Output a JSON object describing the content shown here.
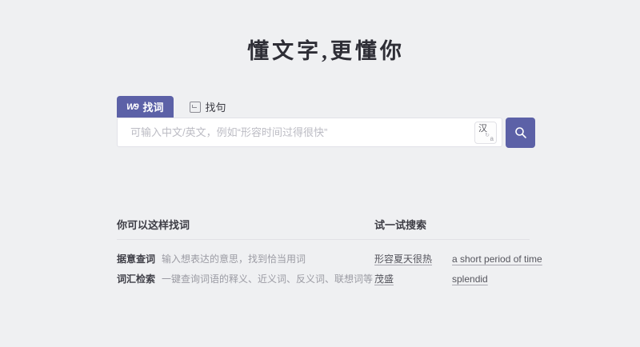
{
  "page": {
    "title": "懂文字,更懂你"
  },
  "colors": {
    "background": "#eff0f2",
    "accent_purple": "#5c61a7",
    "divider": "#e1e1e6",
    "muted_text": "#9b9ba3"
  },
  "tabs": [
    {
      "label": "找词",
      "active": true,
      "icon": "wantwords-logo",
      "logo_text": "W9"
    },
    {
      "label": "找句",
      "active": false,
      "icon": "wantquotes-quote-icon"
    }
  ],
  "search": {
    "placeholder": "可输入中文/英文，例如“形容时间过得很快”",
    "value": "",
    "lang_toggle": {
      "primary": "汉",
      "secondary": "a",
      "arrow": "↻",
      "name": "language-translate-toggle"
    },
    "button_icon": "search-magnifier"
  },
  "guide": {
    "title": "你可以这样找词",
    "items": [
      {
        "label": "据意查词",
        "desc": "输入想表达的意思，找到恰当用词"
      },
      {
        "label": "词汇检索",
        "desc": "一键查询词语的释义、近义词、反义词、联想词等"
      }
    ]
  },
  "examples": {
    "title": "试一试搜索",
    "items": [
      "形容夏天很热",
      "a short period of time",
      "茂盛",
      "splendid"
    ]
  }
}
